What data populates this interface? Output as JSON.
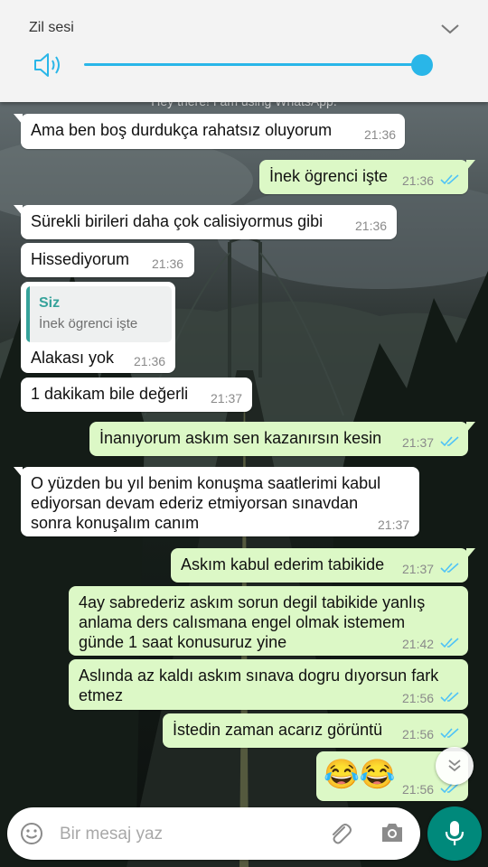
{
  "volume_panel": {
    "title": "Zil sesi",
    "level": 1.0,
    "accent_color": "#29b6e8",
    "speaker_icon": "speaker-icon",
    "collapse_icon": "chevron-down-icon"
  },
  "chat": {
    "status_peek": "Hey there! I am using WhatsApp.",
    "messages": [
      {
        "dir": "in",
        "text": "Ama ben boş durdukça rahatsız oluyorum",
        "time": "21:36"
      },
      {
        "dir": "out",
        "text": "İnek ögrenci işte",
        "time": "21:36",
        "read": true
      },
      {
        "dir": "in",
        "text": "Sürekli birileri daha çok calisiyormus gibi",
        "time": "21:36"
      },
      {
        "dir": "in",
        "text": "Hissediyorum",
        "time": "21:36"
      },
      {
        "dir": "in",
        "quote_author": "Siz",
        "quote_text": "İnek ögrenci işte",
        "text": "Alakası yok",
        "time": "21:36"
      },
      {
        "dir": "in",
        "text": "1 dakikam bile değerli",
        "time": "21:37"
      },
      {
        "dir": "out",
        "text": "İnanıyorum askım sen kazanırsın kesin",
        "time": "21:37",
        "read": true
      },
      {
        "dir": "in",
        "lines": [
          "O yüzden bu yıl benim konuşma saatlerimi kabul",
          "ediyorsan devam ederiz etmiyorsan sınavdan",
          "sonra konuşalım canım"
        ],
        "time": "21:37"
      },
      {
        "dir": "out",
        "text": "Askım kabul ederim tabikide",
        "time": "21:37",
        "read": true
      },
      {
        "dir": "out",
        "lines": [
          "4ay sabrederiz askım sorun degil tabikide yanlış",
          "anlama ders calısmana engel olmak istemem",
          "günde 1 saat konusuruz yine"
        ],
        "time": "21:42",
        "read": true
      },
      {
        "dir": "out",
        "lines": [
          "Aslında az kaldı askım sınava dogru dıyorsun fark",
          "etmez"
        ],
        "time": "21:56",
        "read": true
      },
      {
        "dir": "out",
        "text": "İstedin zaman acarız görüntü",
        "time": "21:56",
        "read": true
      },
      {
        "dir": "out",
        "text": "😂😂",
        "time": "21:56",
        "read": true
      }
    ]
  },
  "input_bar": {
    "placeholder": "Bir mesaj yaz",
    "emoji_icon": "emoji-icon",
    "attach_icon": "paperclip-icon",
    "camera_icon": "camera-icon",
    "mic_icon": "microphone-icon",
    "accent_color": "#00897b"
  },
  "scroll_down_icon": "chevron-double-down-icon",
  "read_tick_color": "#4fc3f7"
}
